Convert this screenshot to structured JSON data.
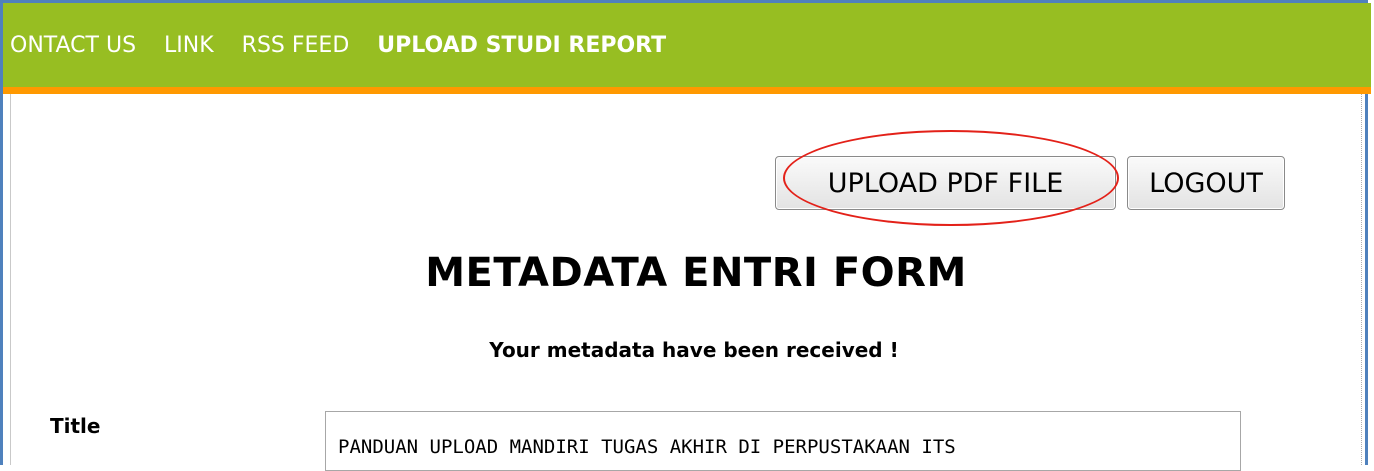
{
  "nav": {
    "items": [
      {
        "label": "ONTACT US",
        "active": false
      },
      {
        "label": "LINK",
        "active": false
      },
      {
        "label": "RSS FEED",
        "active": false
      },
      {
        "label": "UPLOAD STUDI REPORT",
        "active": true
      }
    ]
  },
  "toolbar": {
    "upload_pdf_label": "UPLOAD PDF FILE",
    "logout_label": "LOGOUT"
  },
  "form": {
    "title": "METADATA ENTRI FORM",
    "status_message": "Your metadata have been received !",
    "fields": {
      "title_label": "Title",
      "title_value": "PANDUAN UPLOAD MANDIRI TUGAS AKHIR DI PERPUSTAKAAN ITS"
    }
  },
  "colors": {
    "navbar_bg": "#97be22",
    "accent_rule": "#ff9900",
    "highlight_ring": "#e32119",
    "frame_border": "#4f81bd"
  }
}
